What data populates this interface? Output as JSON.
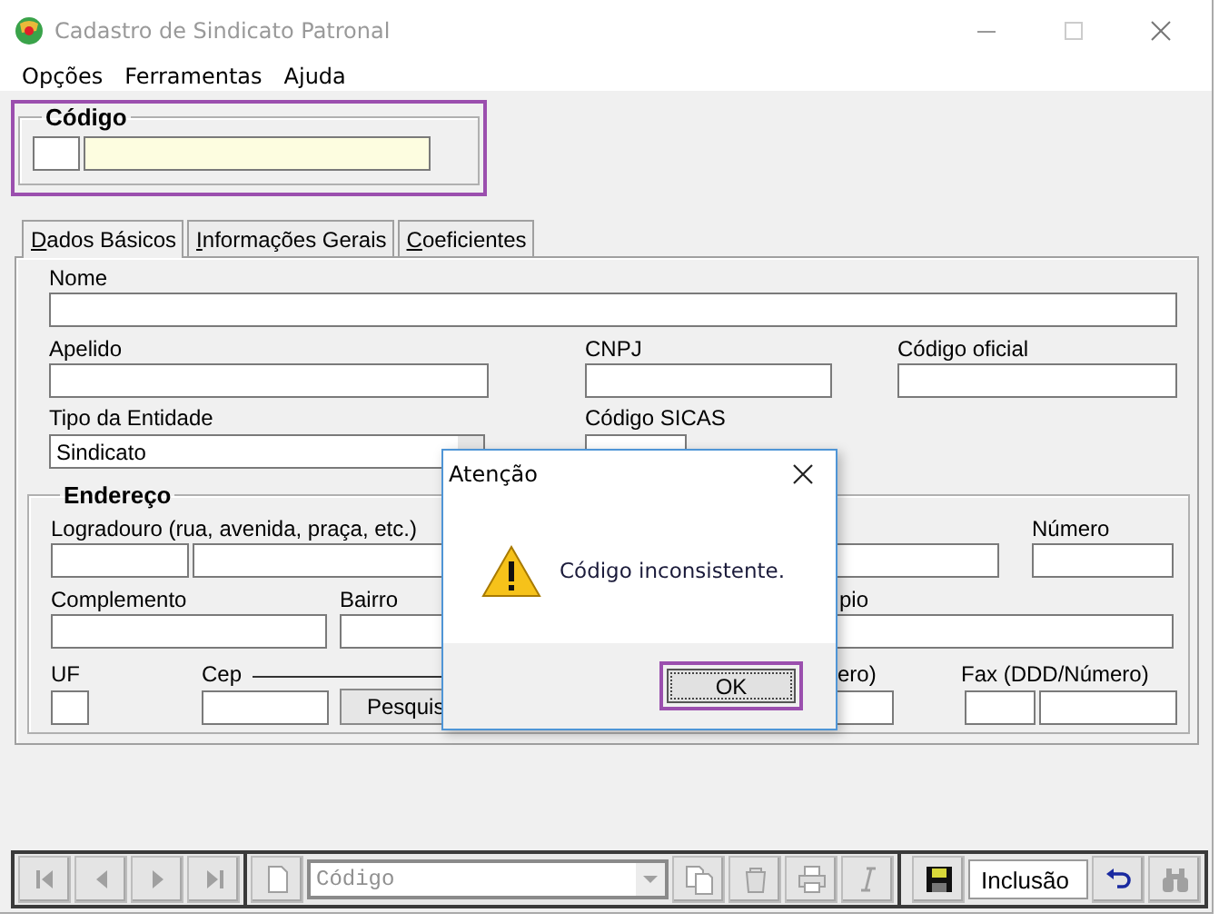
{
  "window": {
    "title": "Cadastro de Sindicato Patronal"
  },
  "menu": [
    {
      "label": "Opções"
    },
    {
      "label": "Ferramentas"
    },
    {
      "label": "Ajuda"
    }
  ],
  "codigo": {
    "legend": "Código",
    "highlighted": true
  },
  "tabs": [
    {
      "label": "Dados Básicos",
      "selected": true
    },
    {
      "label": "Informações Gerais",
      "selected": false
    },
    {
      "label": "Coeficientes",
      "selected": false
    }
  ],
  "basic": {
    "nome": "Nome",
    "apelido": "Apelido",
    "cnpj": "CNPJ",
    "codigo_oficial": "Código oficial",
    "tipo_entidade": {
      "label": "Tipo da Entidade",
      "value": "Sindicato"
    },
    "codigo_sicas": "Código SICAS"
  },
  "endereco": {
    "legend": "Endereço",
    "logradouro": "Logradouro (rua, avenida, praça, etc.)",
    "numero": "Número",
    "complemento": "Complemento",
    "bairro": "Bairro",
    "municipio": "pio",
    "uf": "UF",
    "cep": "Cep",
    "pesquisar": "Pesquis",
    "telefone": "ero)",
    "fax": "Fax (DDD/Número)"
  },
  "dialog": {
    "title": "Atenção",
    "message": "Código inconsistente.",
    "ok": {
      "label": "OK",
      "highlighted": true
    }
  },
  "toolbar": {
    "navigation": [
      {
        "kind": "first",
        "disabled": true
      },
      {
        "kind": "previous",
        "disabled": true
      },
      {
        "kind": "next",
        "disabled": true
      },
      {
        "kind": "last",
        "disabled": true
      }
    ],
    "new_button": {
      "disabled": true
    },
    "search_combo": {
      "value": "Código",
      "disabled": true
    },
    "actions": [
      {
        "kind": "copy",
        "disabled": true
      },
      {
        "kind": "delete",
        "disabled": true
      },
      {
        "kind": "print",
        "disabled": true
      },
      {
        "kind": "italic",
        "disabled": true
      }
    ],
    "save_button": {
      "disabled": false
    },
    "mode": "Inclusão",
    "undo_button": {
      "disabled": false
    },
    "find_button": {
      "disabled": true
    }
  }
}
